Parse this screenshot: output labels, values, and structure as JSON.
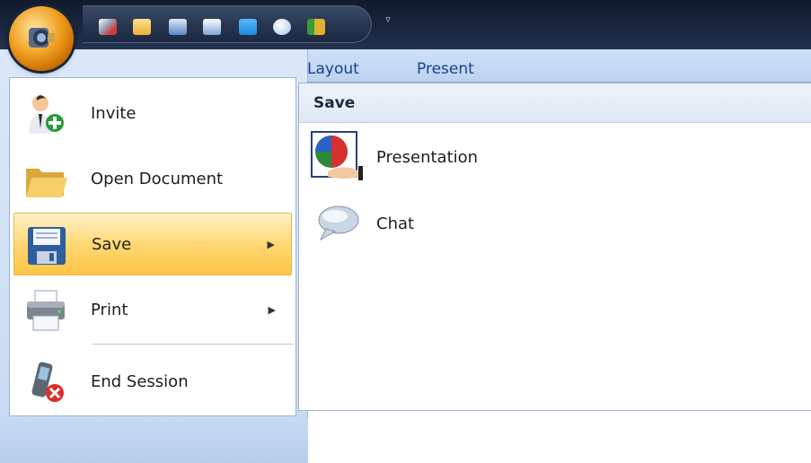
{
  "window": {
    "qat_icons": [
      "pen-icon",
      "folder-icon",
      "whiteboard-icon",
      "slide-icon",
      "monitor-icon",
      "chat-icon",
      "exit-icon"
    ],
    "qat_dropdown": "▿",
    "qat_colors": [
      "#cf3a3a",
      "#e7b13a",
      "#5a86c4",
      "#7ea6d6",
      "#1c8ae0",
      "#a9c7e2",
      "#e0b030"
    ]
  },
  "ribbon": {
    "tabs": [
      "Layout",
      "Present"
    ]
  },
  "app_menu": {
    "items": [
      {
        "label": "Invite",
        "icon": "invite-user-icon",
        "submenu": false
      },
      {
        "label": "Open Document",
        "icon": "folder-open-icon",
        "submenu": false
      },
      {
        "label": "Save",
        "icon": "floppy-disk-icon",
        "submenu": true,
        "selected": true
      },
      {
        "label": "Print",
        "icon": "printer-icon",
        "submenu": true
      },
      {
        "label": "End Session",
        "icon": "end-session-phone-icon",
        "submenu": false
      }
    ],
    "arrow": "▶",
    "submenu": {
      "header": "Save",
      "items": [
        {
          "label": "Presentation",
          "icon": "presentation-icon"
        },
        {
          "label": "Chat",
          "icon": "chat-bubble-icon"
        }
      ]
    }
  },
  "colors": {
    "selected_gradient": "#ffd66e",
    "ribbon_text": "#15428b",
    "title_bar": "#1a2740"
  }
}
